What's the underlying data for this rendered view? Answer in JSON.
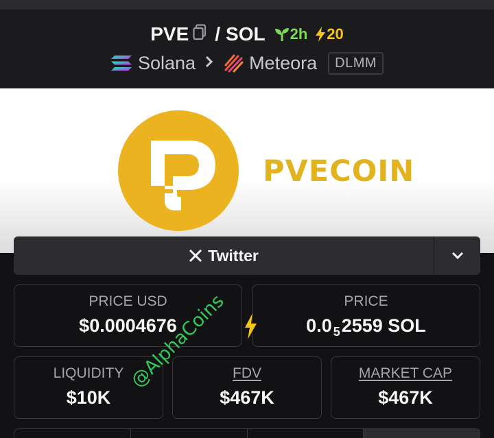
{
  "header": {
    "base_symbol": "PVE",
    "separator": "/",
    "quote_symbol": "SOL",
    "age": "2h",
    "boosts": "20",
    "chain": "Solana",
    "dex": "Meteora",
    "pool_type": "DLMM"
  },
  "banner": {
    "logo_text": "PVECOIN",
    "logo_color": "#ecb320"
  },
  "socials": {
    "twitter_label": "Twitter"
  },
  "stats": {
    "price_usd_label": "PRICE USD",
    "price_usd_value": "$0.0004676",
    "price_label": "PRICE",
    "price_value_prefix": "0.0",
    "price_value_zeros": "5",
    "price_value_suffix": "2559 SOL",
    "liquidity_label": "LIQUIDITY",
    "liquidity_value": "$10K",
    "fdv_label": "FDV",
    "fdv_value": "$467K",
    "mcap_label": "MARKET CAP",
    "mcap_value": "$467K"
  },
  "watermark": "@AlphaCoins",
  "colors": {
    "age_green": "#7ed957",
    "boost_yellow": "#f5c518",
    "watermark_green": "#35c759"
  }
}
